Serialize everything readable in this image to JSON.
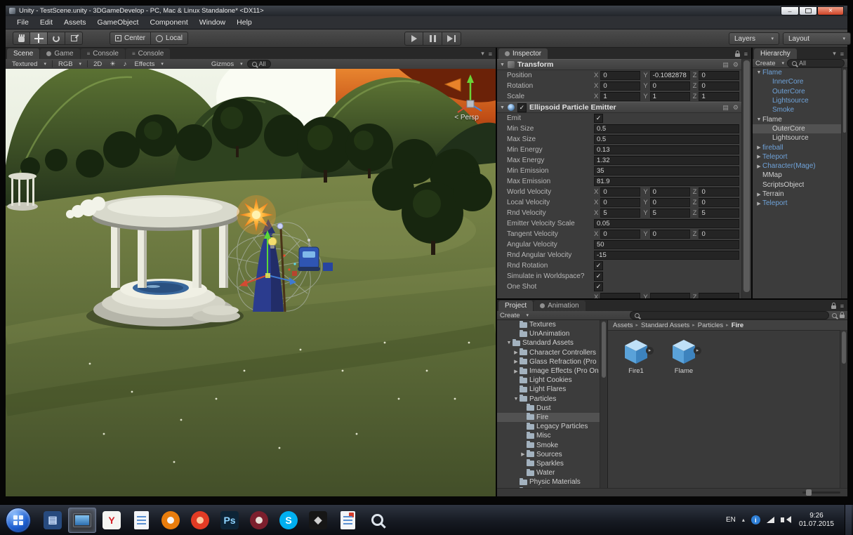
{
  "window": {
    "title": "Unity - TestScene.unity - 3DGameDevelop - PC, Mac & Linux Standalone* <DX11>",
    "controls": {
      "minimize": "–",
      "close": "×"
    }
  },
  "menu": {
    "items": [
      "File",
      "Edit",
      "Assets",
      "GameObject",
      "Component",
      "Window",
      "Help"
    ]
  },
  "toolbar": {
    "pivot_label": "Center",
    "space_label": "Local",
    "layers_label": "Layers",
    "layout_label": "Layout"
  },
  "scene_panel": {
    "tabs": [
      {
        "label": "Scene",
        "active": true,
        "icon": "none"
      },
      {
        "label": "Game",
        "active": false,
        "icon": "dot"
      },
      {
        "label": "Console",
        "active": false,
        "icon": "lines"
      },
      {
        "label": "Console",
        "active": false,
        "icon": "lines"
      }
    ],
    "bar": {
      "shading": "Textured",
      "channel": "RGB",
      "mode_2d": "2D",
      "effects": "Effects",
      "gizmos": "Gizmos",
      "search_value": "All"
    },
    "persp_label": "< Persp"
  },
  "inspector": {
    "tab_label": "Inspector",
    "transform": {
      "title": "Transform",
      "rows": [
        {
          "label": "Position",
          "type": "xyz",
          "x": "0",
          "y": "-0.1082878",
          "z": "0"
        },
        {
          "label": "Rotation",
          "type": "xyz",
          "x": "0",
          "y": "0",
          "z": "0"
        },
        {
          "label": "Scale",
          "type": "xyz",
          "x": "1",
          "y": "1",
          "z": "1"
        }
      ]
    },
    "emitter": {
      "title": "Ellipsoid Particle Emitter",
      "enabled": true,
      "rows": [
        {
          "label": "Emit",
          "type": "check",
          "checked": true
        },
        {
          "label": "Min Size",
          "type": "value",
          "value": "0.5"
        },
        {
          "label": "Max Size",
          "type": "value",
          "value": "0.5"
        },
        {
          "label": "Min Energy",
          "type": "value",
          "value": "0.13"
        },
        {
          "label": "Max Energy",
          "type": "value",
          "value": "1.32"
        },
        {
          "label": "Min Emission",
          "type": "value",
          "value": "35"
        },
        {
          "label": "Max Emission",
          "type": "value",
          "value": "81.9"
        },
        {
          "label": "World Velocity",
          "type": "xyz",
          "x": "0",
          "y": "0",
          "z": "0"
        },
        {
          "label": "Local Velocity",
          "type": "xyz",
          "x": "0",
          "y": "0",
          "z": "0"
        },
        {
          "label": "Rnd Velocity",
          "type": "xyz",
          "x": "5",
          "y": "5",
          "z": "5"
        },
        {
          "label": "Emitter Velocity Scale",
          "type": "value",
          "value": "0.05"
        },
        {
          "label": "Tangent Velocity",
          "type": "xyz",
          "x": "0",
          "y": "0",
          "z": "0"
        },
        {
          "label": "Angular Velocity",
          "type": "value",
          "value": "50"
        },
        {
          "label": "Rnd Angular Velocity",
          "type": "value",
          "value": "-15"
        },
        {
          "label": "Rnd Rotation",
          "type": "check",
          "checked": true
        },
        {
          "label": "Simulate in Worldspace?",
          "type": "check",
          "checked": true
        },
        {
          "label": "One Shot",
          "type": "check",
          "checked": true
        },
        {
          "label": "",
          "type": "xyz",
          "x": "",
          "y": "",
          "z": ""
        }
      ]
    }
  },
  "hierarchy": {
    "tab_label": "Hierarchy",
    "create_label": "Create",
    "search_value": "All",
    "items": [
      {
        "label": "Flame",
        "indent": 0,
        "arrow": "open",
        "color": "blue"
      },
      {
        "label": "InnerCore",
        "indent": 1,
        "arrow": null,
        "color": "blue"
      },
      {
        "label": "OuterCore",
        "indent": 1,
        "arrow": null,
        "color": "blue"
      },
      {
        "label": "Lightsource",
        "indent": 1,
        "arrow": null,
        "color": "blue"
      },
      {
        "label": "Smoke",
        "indent": 1,
        "arrow": null,
        "color": "blue"
      },
      {
        "label": "Flame",
        "indent": 0,
        "arrow": "open",
        "color": "white"
      },
      {
        "label": "OuterCore",
        "indent": 1,
        "arrow": null,
        "color": "white",
        "selected": true
      },
      {
        "label": "Lightsource",
        "indent": 1,
        "arrow": null,
        "color": "white"
      },
      {
        "label": "fireball",
        "indent": 0,
        "arrow": "closed",
        "color": "blue"
      },
      {
        "label": "Teleport",
        "indent": 0,
        "arrow": "closed",
        "color": "blue"
      },
      {
        "label": "Character(Mage)",
        "indent": 0,
        "arrow": "closed",
        "color": "blue"
      },
      {
        "label": "MMap",
        "indent": 0,
        "arrow": null,
        "color": "white"
      },
      {
        "label": "ScriptsObject",
        "indent": 0,
        "arrow": null,
        "color": "white"
      },
      {
        "label": "Terrain",
        "indent": 0,
        "arrow": "closed",
        "color": "white"
      },
      {
        "label": "Teleport",
        "indent": 0,
        "arrow": "closed",
        "color": "blue"
      }
    ]
  },
  "project": {
    "tab_label": "Project",
    "animation_tab_label": "Animation",
    "create_label": "Create",
    "breadcrumb": [
      "Assets",
      "Standard Assets",
      "Particles",
      "Fire"
    ],
    "tree": [
      {
        "label": "Textures",
        "indent": 2,
        "arrow": null
      },
      {
        "label": "UnAnimation",
        "indent": 2,
        "arrow": null
      },
      {
        "label": "Standard Assets",
        "indent": 1,
        "arrow": "open"
      },
      {
        "label": "Character Controllers",
        "indent": 2,
        "arrow": "closed"
      },
      {
        "label": "Glass Refraction (Pro",
        "indent": 2,
        "arrow": "closed"
      },
      {
        "label": "Image Effects (Pro On",
        "indent": 2,
        "arrow": "closed"
      },
      {
        "label": "Light Cookies",
        "indent": 2,
        "arrow": null
      },
      {
        "label": "Light Flares",
        "indent": 2,
        "arrow": null
      },
      {
        "label": "Particles",
        "indent": 2,
        "arrow": "open"
      },
      {
        "label": "Dust",
        "indent": 3,
        "arrow": null
      },
      {
        "label": "Fire",
        "indent": 3,
        "arrow": null,
        "selected": true
      },
      {
        "label": "Legacy Particles",
        "indent": 3,
        "arrow": null
      },
      {
        "label": "Misc",
        "indent": 3,
        "arrow": null
      },
      {
        "label": "Smoke",
        "indent": 3,
        "arrow": null
      },
      {
        "label": "Sources",
        "indent": 3,
        "arrow": "closed"
      },
      {
        "label": "Sparkles",
        "indent": 3,
        "arrow": null
      },
      {
        "label": "Water",
        "indent": 3,
        "arrow": null
      },
      {
        "label": "Physic Materials",
        "indent": 2,
        "arrow": null
      },
      {
        "label": "Projectors",
        "indent": 2,
        "arrow": null
      }
    ],
    "assets": [
      {
        "name": "Fire1"
      },
      {
        "name": "Flame"
      }
    ]
  },
  "taskbar": {
    "items": [
      {
        "name": "library-icon",
        "kind": "glyph",
        "glyph": "▤",
        "bg": "#274a7e",
        "fg": "#cfe3ff"
      },
      {
        "name": "active-window-monitor-icon",
        "kind": "monitor",
        "active": true
      },
      {
        "name": "yandex-browser-icon",
        "kind": "glyph",
        "glyph": "Y",
        "bg": "#f5f5f2",
        "fg": "#d41f26"
      },
      {
        "name": "document-editor-icon",
        "kind": "page"
      },
      {
        "name": "blender-icon",
        "kind": "circle",
        "bg": "#e87d0d",
        "inner": "#f4f4f4"
      },
      {
        "name": "red-browser-icon",
        "kind": "circle",
        "bg": "#e23b24",
        "inner": "#f8c8a0"
      },
      {
        "name": "photoshop-icon",
        "kind": "glyph",
        "glyph": "Ps",
        "bg": "#0d2436",
        "fg": "#8fd4ff"
      },
      {
        "name": "dark-red-app-icon",
        "kind": "circle",
        "bg": "#7c1f2d",
        "inner": "#e8e0d8"
      },
      {
        "name": "skype-icon",
        "kind": "glyph",
        "glyph": "S",
        "bg": "#00aff0",
        "fg": "#ffffff",
        "round": true
      },
      {
        "name": "unity-editor-icon",
        "kind": "glyph",
        "glyph": "◆",
        "bg": "#161616",
        "fg": "#cfcfcf"
      },
      {
        "name": "red-accent-app-icon",
        "kind": "page",
        "accent": "#d43b2a"
      },
      {
        "name": "search-magnifier-icon",
        "kind": "magnifier"
      }
    ],
    "tray": {
      "lang": "EN",
      "info_glyph": "i",
      "time": "9:26",
      "date": "01.07.2015"
    }
  },
  "icons": {
    "dropdown_arrow": "▾",
    "foldout_open": "▼",
    "foldout_closed": "▶",
    "check": "✓",
    "gear": "⚙",
    "book": "▤",
    "menu": "≡",
    "sun": "☀",
    "audio": "♪",
    "breadcrumb_sep": "▸",
    "prefab_arrow": "▸",
    "tray_arrow": "▴"
  },
  "colors": {
    "prefab_text_blue": "#6fa2d8",
    "selection_gray": "#525252",
    "prefab_cube_blue": "#5aa2d9",
    "flame_orange": "#ff8c1a"
  }
}
